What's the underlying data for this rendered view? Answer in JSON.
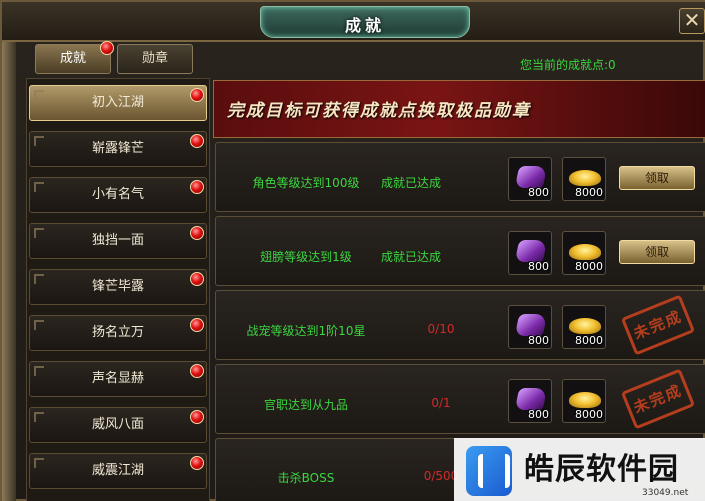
{
  "window": {
    "title": "成就",
    "close_glyph": "✕"
  },
  "tabs": [
    {
      "label": "成就",
      "active": true,
      "has_badge": true
    },
    {
      "label": "勋章",
      "active": false,
      "has_badge": false
    }
  ],
  "points_text": "您当前的成就点:0",
  "sidebar": {
    "items": [
      {
        "label": "初入江湖",
        "active": true
      },
      {
        "label": "崭露锋芒",
        "active": false
      },
      {
        "label": "小有名气",
        "active": false
      },
      {
        "label": "独挡一面",
        "active": false
      },
      {
        "label": "锋芒毕露",
        "active": false
      },
      {
        "label": "扬名立万",
        "active": false
      },
      {
        "label": "声名显赫",
        "active": false
      },
      {
        "label": "威风八面",
        "active": false
      },
      {
        "label": "威震江湖",
        "active": false
      }
    ]
  },
  "banner_text": "完成目标可获得成就点换取极品勋章",
  "achievements": [
    {
      "title": "角色等级达到100级",
      "status": "成就已达成",
      "status_type": "done",
      "reward1": {
        "icon": "purple-scroll-icon",
        "qty": "800"
      },
      "reward2": {
        "icon": "gold-ingot-icon",
        "qty": "8000"
      },
      "action": "领取"
    },
    {
      "title": "翅膀等级达到1级",
      "status": "成就已达成",
      "status_type": "done",
      "reward1": {
        "icon": "purple-scroll-icon",
        "qty": "800"
      },
      "reward2": {
        "icon": "gold-ingot-icon",
        "qty": "8000"
      },
      "action": "领取"
    },
    {
      "title": "战宠等级达到1阶10星",
      "status": "0/10",
      "status_type": "progress",
      "reward1": {
        "icon": "purple-scroll-icon",
        "qty": "800"
      },
      "reward2": {
        "icon": "gold-ingot-icon",
        "qty": "8000"
      },
      "stamp": "未完成"
    },
    {
      "title": "官职达到从九品",
      "status": "0/1",
      "status_type": "progress",
      "reward1": {
        "icon": "purple-scroll-icon",
        "qty": "800"
      },
      "reward2": {
        "icon": "gold-ingot-icon",
        "qty": "8000"
      },
      "stamp": "未完成"
    },
    {
      "title": "击杀BOSS",
      "status": "0/500",
      "status_type": "progress"
    }
  ],
  "watermark": {
    "title": "皓辰软件园",
    "url": "33049.net"
  },
  "colors": {
    "accent_green": "#3cd640",
    "progress_red": "#d32a2a",
    "badge_red": "#e01010"
  }
}
